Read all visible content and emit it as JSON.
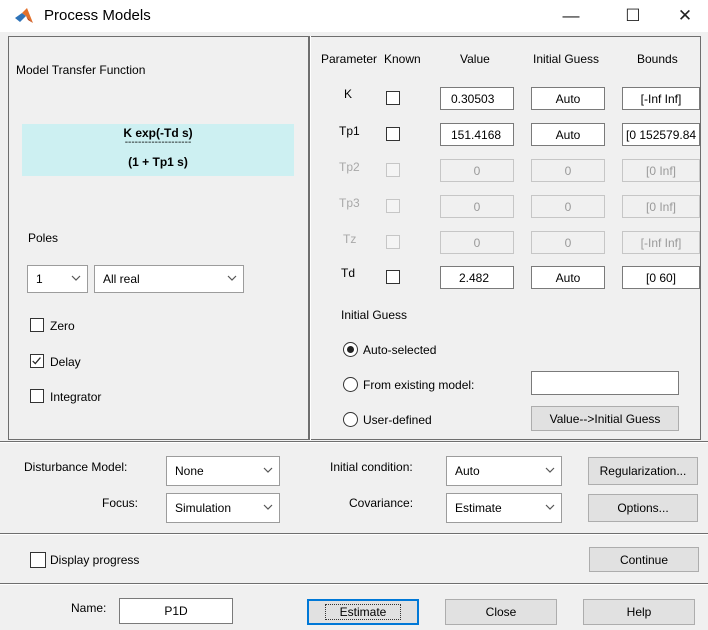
{
  "window": {
    "title": "Process Models",
    "minimize": "—",
    "maximize": "☐",
    "close": "✕"
  },
  "left": {
    "transfer_label": "Model Transfer Function",
    "formula_num": "K exp(-Td s)",
    "formula_dashes": "--------------------",
    "formula_den": "(1 + Tp1 s)",
    "poles_label": "Poles",
    "poles_count": "1",
    "poles_type": "All real",
    "zero_label": "Zero",
    "delay_label": "Delay",
    "integrator_label": "Integrator",
    "zero_checked": false,
    "delay_checked": true,
    "integrator_checked": false
  },
  "params": {
    "headers": {
      "parameter": "Parameter",
      "known": "Known",
      "value": "Value",
      "guess": "Initial Guess",
      "bounds": "Bounds"
    },
    "rows": [
      {
        "name": "K",
        "value": "0.30503",
        "guess": "Auto",
        "bounds": "[-Inf Inf]",
        "enabled": true
      },
      {
        "name": "Tp1",
        "value": "151.4168",
        "guess": "Auto",
        "bounds": "[0 152579.84",
        "enabled": true
      },
      {
        "name": "Tp2",
        "value": "0",
        "guess": "0",
        "bounds": "[0 Inf]",
        "enabled": false
      },
      {
        "name": "Tp3",
        "value": "0",
        "guess": "0",
        "bounds": "[0 Inf]",
        "enabled": false
      },
      {
        "name": "Tz",
        "value": "0",
        "guess": "0",
        "bounds": "[-Inf Inf]",
        "enabled": false
      },
      {
        "name": "Td",
        "value": "2.482",
        "guess": "Auto",
        "bounds": "[0 60]",
        "enabled": true
      }
    ],
    "initial_guess_label": "Initial Guess",
    "opt_auto": "Auto-selected",
    "opt_existing": "From existing model:",
    "opt_user": "User-defined",
    "existing_model_value": "",
    "value_to_guess_button": "Value-->Initial Guess"
  },
  "options": {
    "disturbance_label": "Disturbance Model:",
    "disturbance_value": "None",
    "focus_label": "Focus:",
    "focus_value": "Simulation",
    "initcond_label": "Initial condition:",
    "initcond_value": "Auto",
    "covariance_label": "Covariance:",
    "covariance_value": "Estimate",
    "regularization_button": "Regularization...",
    "options_button": "Options..."
  },
  "progress": {
    "display_label": "Display progress",
    "continue_button": "Continue"
  },
  "footer": {
    "name_label": "Name:",
    "name_value": "P1D",
    "estimate_button": "Estimate",
    "close_button": "Close",
    "help_button": "Help"
  }
}
